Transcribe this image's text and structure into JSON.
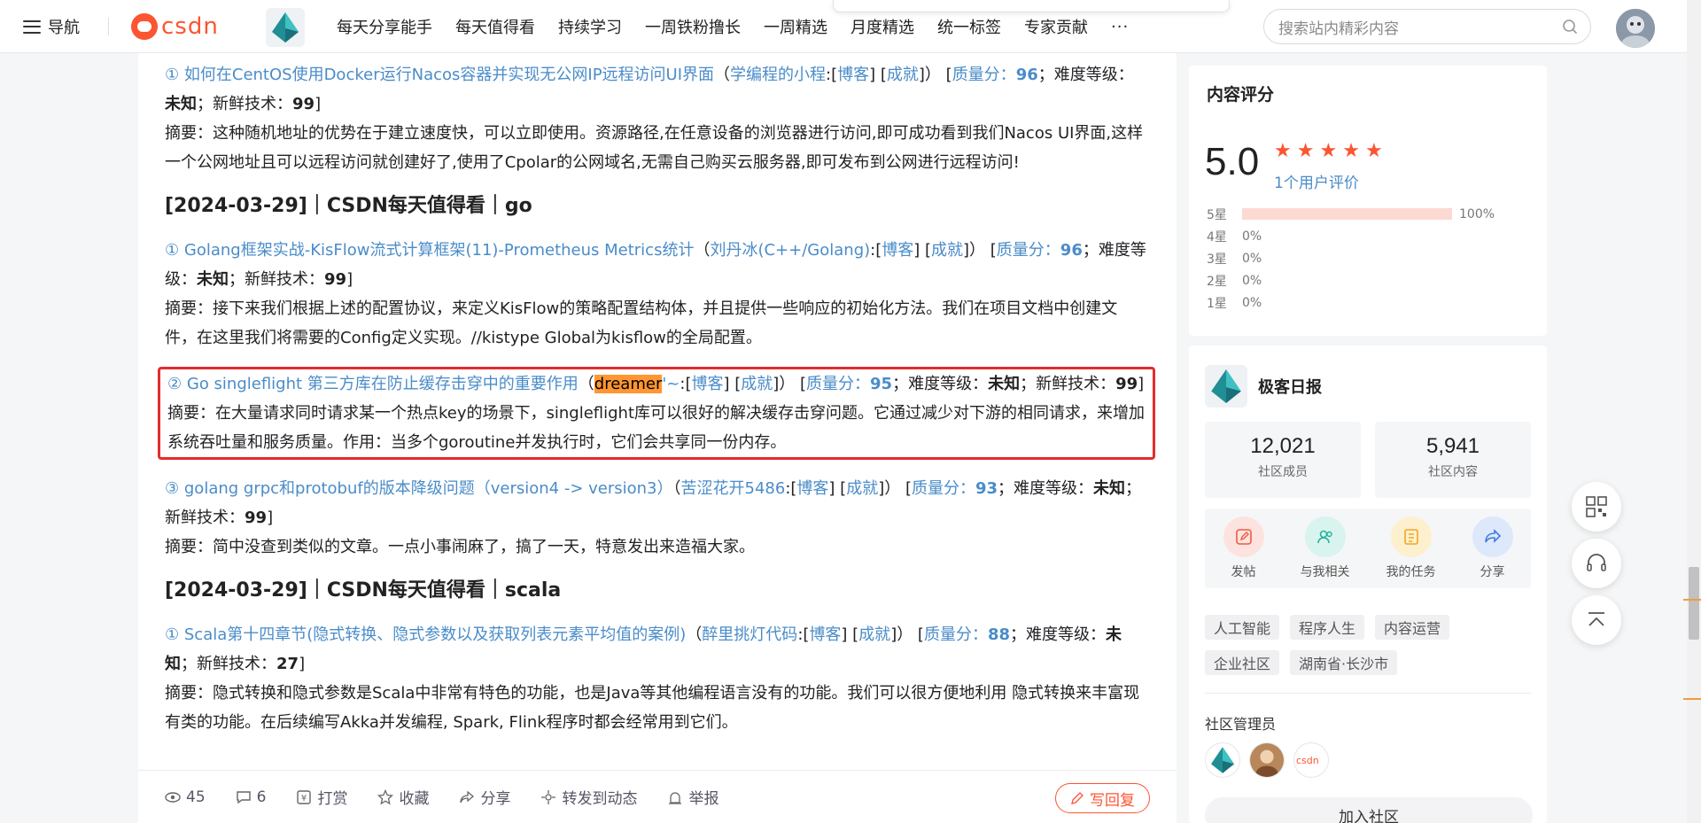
{
  "topbar": {
    "nav_label": "导航",
    "logo_text": "csdn",
    "nav_items": [
      "每天分享能手",
      "每天值得看",
      "持续学习",
      "一周铁粉撸长",
      "一周精选",
      "月度精选",
      "统一标签",
      "专家贡献"
    ],
    "more": "···",
    "search_placeholder": "搜索站内精彩内容"
  },
  "article": {
    "entry1": {
      "num": "①",
      "title": "如何在CentOS使用Docker运行Nacos容器并实现无公网IP远程访问UI界面",
      "author": "学编程的小程",
      "blog": "博客",
      "achievement": "成就",
      "quality_label": "质量分：",
      "quality": "96",
      "difficulty_label": "难度等级：",
      "difficulty": "未知",
      "fresh_label": "新鲜技术：",
      "fresh": "99",
      "summary": "摘要：这种随机地址的优势在于建立速度快，可以立即使用。资源路径,在任意设备的浏览器进行访问,即可成功看到我们Nacos UI界面,这样一个公网地址且可以远程访问就创建好了,使用了Cpolar的公网域名,无需自己购买云服务器,即可发布到公网进行远程访问!"
    },
    "section_go": "[2024-03-29]｜CSDN每天值得看｜go",
    "entry2": {
      "num": "①",
      "title": "Golang框架实战-KisFlow流式计算框架(11)-Prometheus Metrics统计",
      "author": "刘丹冰(C++/Golang)",
      "blog": "博客",
      "achievement": "成就",
      "quality_label": "质量分：",
      "quality": "96",
      "difficulty_label": "难度等级：",
      "difficulty": "未知",
      "fresh_label": "新鲜技术：",
      "fresh": "99",
      "summary": "摘要：接下来我们根据上述的配置协议，来定义KisFlow的策略配置结构体，并且提供一些响应的初始化方法。我们在项目文档中创建文件，在这里我们将需要的Config定义实现。//kistype Global为kisflow的全局配置。"
    },
    "entry3": {
      "num": "②",
      "title": "Go singleflight 第三方库在防止缓存击穿中的重要作用",
      "author_highlight": "dreamer",
      "author_rest": "'~",
      "blog": "博客",
      "achievement": "成就",
      "quality_label": "质量分：",
      "quality": "95",
      "difficulty_label": "难度等级：",
      "difficulty": "未知",
      "fresh_label": "新鲜技术：",
      "fresh": "99",
      "summary": "摘要：在大量请求同时请求某一个热点key的场景下，singleflight库可以很好的解决缓存击穿问题。它通过减少对下游的相同请求，来增加系统吞吐量和服务质量。作用：当多个goroutine并发执行时，它们会共享同一份内存。"
    },
    "entry4": {
      "num": "③",
      "title": "golang grpc和protobuf的版本降级问题（version4 -> version3）",
      "author": "苦涩花开5486",
      "blog": "博客",
      "achievement": "成就",
      "quality_label": "质量分：",
      "quality": "93",
      "difficulty_label": "难度等级：",
      "difficulty": "未知",
      "fresh_label": "新鲜技术：",
      "fresh": "99",
      "summary": "摘要：简中没查到类似的文章。一点小事闹麻了，搞了一天，特意发出来造福大家。"
    },
    "section_scala": "[2024-03-29]｜CSDN每天值得看｜scala",
    "entry5": {
      "num": "①",
      "title": "Scala第十四章节(隐式转换、隐式参数以及获取列表元素平均值的案例)",
      "author": "醉里挑灯代码",
      "blog": "博客",
      "achievement": "成就",
      "quality_label": "质量分：",
      "quality": "88",
      "difficulty_label": "难度等级：",
      "difficulty": "未知",
      "fresh_label": "新鲜技术：",
      "fresh": "27",
      "summary": "摘要：隐式转换和隐式参数是Scala中非常有特色的功能，也是Java等其他编程语言没有的功能。我们可以很方便地利用 隐式转换来丰富现有类的功能。在后续编写Akka并发编程, Spark, Flink程序时都会经常用到它们。"
    }
  },
  "actionbar": {
    "views": "45",
    "comments": "6",
    "reward": "打赏",
    "collect": "收藏",
    "share": "分享",
    "forward": "转发到动态",
    "report": "举报",
    "reply": "写回复"
  },
  "rating": {
    "title": "内容评分",
    "score": "5.0",
    "count_text": "1个用户评价",
    "rows": [
      {
        "label": "5星",
        "pct": "100%",
        "value": 100
      },
      {
        "label": "4星",
        "pct": "0%",
        "value": 0
      },
      {
        "label": "3星",
        "pct": "0%",
        "value": 0
      },
      {
        "label": "2星",
        "pct": "0%",
        "value": 0
      },
      {
        "label": "1星",
        "pct": "0%",
        "value": 0
      }
    ]
  },
  "community": {
    "name": "极客日报",
    "members": "12,021",
    "members_label": "社区成员",
    "contents": "5,941",
    "contents_label": "社区内容",
    "actions": [
      "发帖",
      "与我相关",
      "我的任务",
      "分享"
    ],
    "tags": [
      "人工智能",
      "程序人生",
      "内容运营",
      "企业社区",
      "湖南省·长沙市"
    ],
    "admin_title": "社区管理员",
    "join": "加入社区"
  },
  "colors": {
    "accent": "#fc5531",
    "link": "#4a8cc9",
    "highlight_border": "#e22d2d",
    "search_highlight": "#ff9632"
  }
}
